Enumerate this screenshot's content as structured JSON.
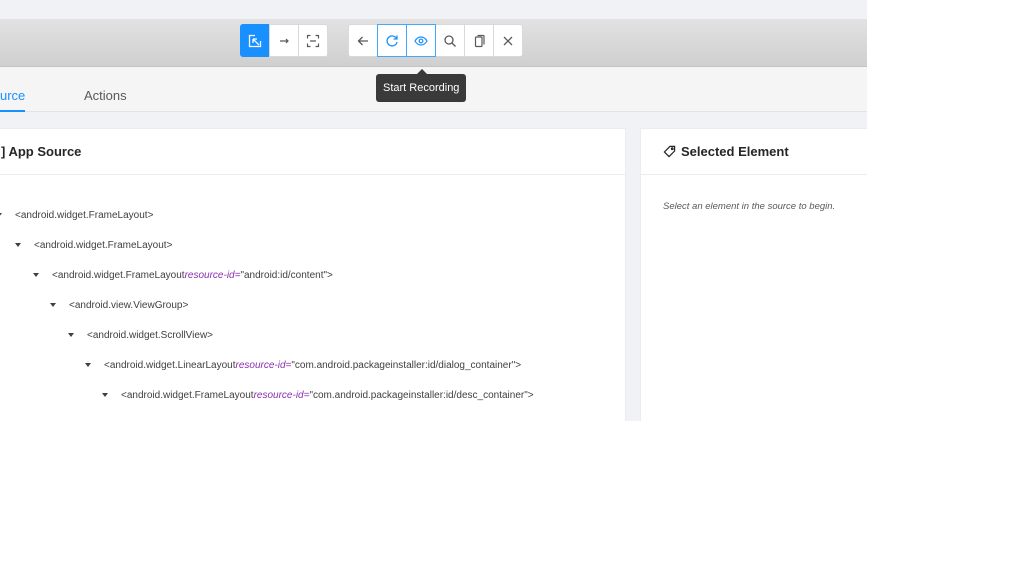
{
  "toolbar": {
    "groups": [
      {
        "name": "mode",
        "buttons": [
          "select-elements-icon",
          "swipe-icon",
          "tap-coordinates-icon"
        ]
      },
      {
        "name": "actions",
        "buttons": [
          "back-icon",
          "refresh-icon",
          "eye-icon",
          "search-icon",
          "copy-icon",
          "close-icon"
        ]
      }
    ],
    "tooltip": "Start Recording"
  },
  "tabs": [
    {
      "label": "urce",
      "active": true
    },
    {
      "label": "Actions",
      "active": false
    }
  ],
  "source_panel": {
    "title": "] App Source",
    "tree": [
      {
        "tag": "<android.widget.FrameLayout>",
        "attr_name": "",
        "attr_value": "",
        "close": ""
      },
      {
        "tag": "<android.widget.FrameLayout>",
        "attr_name": "",
        "attr_value": "",
        "close": ""
      },
      {
        "tag": "<android.widget.FrameLayout ",
        "attr_name": "resource-id=",
        "attr_value": "\"android:id/content\"",
        "close": ">"
      },
      {
        "tag": "<android.view.ViewGroup>",
        "attr_name": "",
        "attr_value": "",
        "close": ""
      },
      {
        "tag": "<android.widget.ScrollView>",
        "attr_name": "",
        "attr_value": "",
        "close": ""
      },
      {
        "tag": "<android.widget.LinearLayout ",
        "attr_name": "resource-id=",
        "attr_value": "\"com.android.packageinstaller:id/dialog_container\"",
        "close": ">"
      },
      {
        "tag": "<android.widget.FrameLayout ",
        "attr_name": "resource-id=",
        "attr_value": "\"com.android.packageinstaller:id/desc_container\"",
        "close": ">"
      }
    ]
  },
  "selected_panel": {
    "title": "Selected Element",
    "hint": "Select an element in the source to begin."
  },
  "colors": {
    "accent": "#1890ff",
    "attribute": "#8b2fb0",
    "tooltip_bg": "#3a3a3a"
  }
}
